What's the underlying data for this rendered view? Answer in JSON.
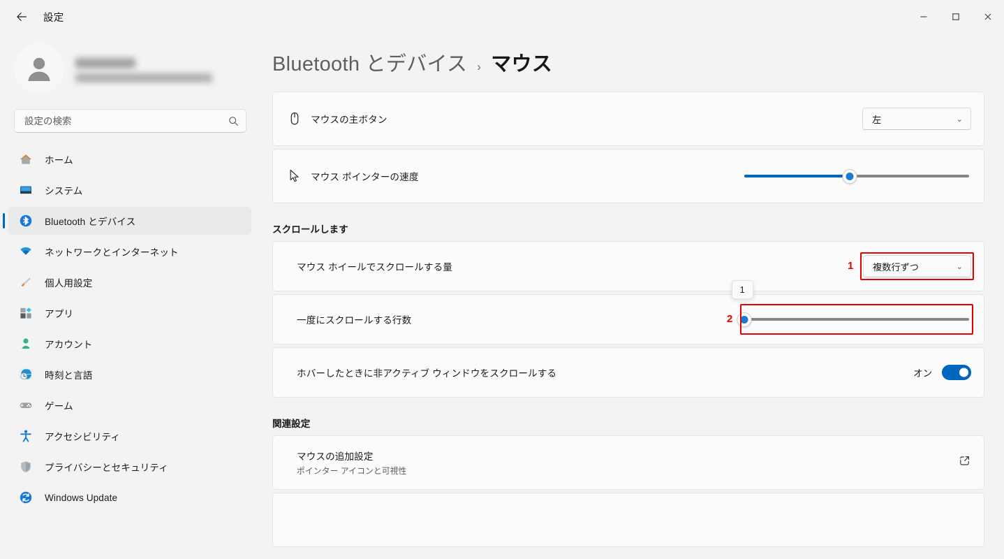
{
  "window": {
    "title": "設定",
    "back_icon": "back-arrow-icon",
    "minimize_label": "最小化",
    "maximize_label": "最大化",
    "close_label": "閉じる"
  },
  "sidebar": {
    "account": {
      "name_redacted": "",
      "email_redacted": "",
      "avatar_icon": "user-avatar-icon"
    },
    "search": {
      "placeholder": "設定の検索",
      "value": "",
      "icon": "search-icon"
    },
    "items": [
      {
        "label": "ホーム",
        "icon": "home-icon",
        "selected": false
      },
      {
        "label": "システム",
        "icon": "system-icon",
        "selected": false
      },
      {
        "label": "Bluetooth とデバイス",
        "icon": "bluetooth-icon",
        "selected": true
      },
      {
        "label": "ネットワークとインターネット",
        "icon": "network-icon",
        "selected": false
      },
      {
        "label": "個人用設定",
        "icon": "personalization-brush-icon",
        "selected": false
      },
      {
        "label": "アプリ",
        "icon": "apps-icon",
        "selected": false
      },
      {
        "label": "アカウント",
        "icon": "accounts-icon",
        "selected": false
      },
      {
        "label": "時刻と言語",
        "icon": "time-language-icon",
        "selected": false
      },
      {
        "label": "ゲーム",
        "icon": "gaming-controller-icon",
        "selected": false
      },
      {
        "label": "アクセシビリティ",
        "icon": "accessibility-icon",
        "selected": false
      },
      {
        "label": "プライバシーとセキュリティ",
        "icon": "privacy-shield-icon",
        "selected": false
      },
      {
        "label": "Windows Update",
        "icon": "windows-update-icon",
        "selected": false
      }
    ]
  },
  "main": {
    "breadcrumb": {
      "parent": "Bluetooth とデバイス",
      "separator": "›",
      "current": "マウス"
    },
    "primary_button": {
      "label": "マウスの主ボタン",
      "icon": "mouse-icon",
      "dropdown_value": "左",
      "chevron": "⌄"
    },
    "pointer_speed": {
      "label": "マウス ポインターの速度",
      "icon": "cursor-arrow-icon",
      "value_percent": 47
    },
    "scroll_section": {
      "heading": "スクロールします",
      "wheel_scroll": {
        "label": "マウス ホイールでスクロールする量",
        "dropdown_value": "複数行ずつ",
        "chevron": "⌄"
      },
      "lines_to_scroll": {
        "label": "一度にスクロールする行数",
        "value": "1",
        "value_percent": 0,
        "tooltip": "1"
      },
      "hover_scroll": {
        "label": "ホバーしたときに非アクティブ ウィンドウをスクロールする",
        "state_label": "オン",
        "on": true
      }
    },
    "related_section": {
      "heading": "関連設定",
      "additional_mouse": {
        "label": "マウスの追加設定",
        "sublabel": "ポインター アイコンと可視性",
        "icon": "external-link-icon"
      }
    }
  },
  "annotations": [
    {
      "number": "1",
      "target": "wheel-scroll-dropdown"
    },
    {
      "number": "2",
      "target": "lines-to-scroll-slider"
    }
  ],
  "colors": {
    "accent": "#0067c0",
    "annotation_red": "#e60000",
    "card_bg": "#fbfbfb",
    "page_bg": "#f3f3f3"
  }
}
